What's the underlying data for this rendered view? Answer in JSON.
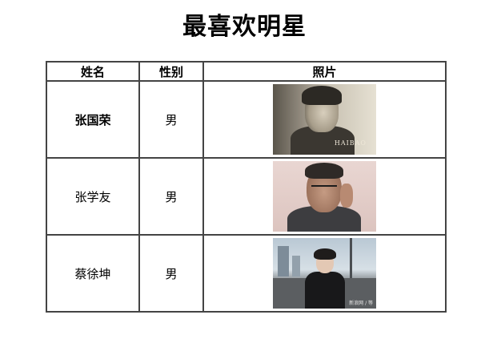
{
  "page": {
    "title": "最喜欢明星"
  },
  "table": {
    "headers": {
      "name": "姓名",
      "gender": "性别",
      "photo": "照片"
    },
    "rows": [
      {
        "name": "张国荣",
        "gender": "男",
        "photo_watermark": "HAIBAO",
        "name_bold": true
      },
      {
        "name": "张学友",
        "gender": "男",
        "photo_watermark": "",
        "name_bold": false
      },
      {
        "name": "蔡徐坤",
        "gender": "男",
        "photo_watermark": "新浪网 / 等",
        "name_bold": false
      }
    ]
  },
  "colors": {
    "background": "#ffffff",
    "border": "#444444",
    "text": "#000000"
  }
}
